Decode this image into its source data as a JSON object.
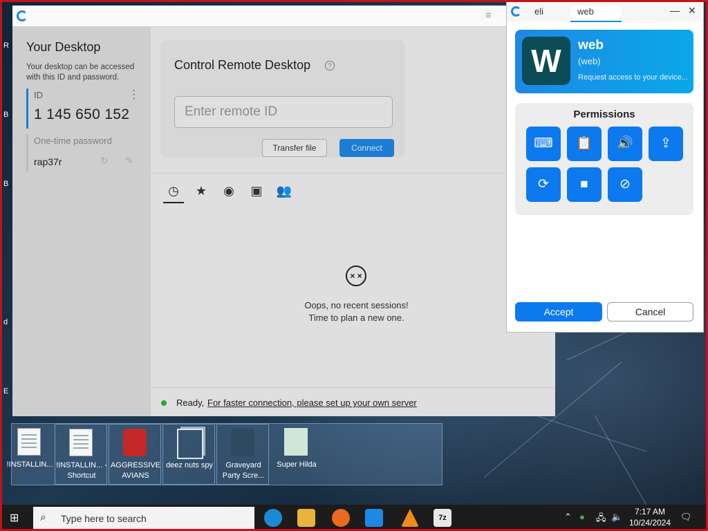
{
  "main_window": {
    "sidebar": {
      "title": "Your Desktop",
      "description": "Your desktop can be accessed with this ID and password.",
      "id_label": "ID",
      "id_value": "1 145 650 152",
      "password_label": "One-time password",
      "password_value": "rap37r"
    },
    "control": {
      "title": "Control Remote Desktop",
      "input_placeholder": "Enter remote ID",
      "transfer_label": "Transfer file",
      "connect_label": "Connect"
    },
    "tabs": [
      "recent-sessions",
      "favorites",
      "discovered",
      "address-book",
      "group"
    ],
    "empty_state": {
      "line1": "Oops, no recent sessions!",
      "line2": "Time to plan a new one."
    },
    "status": {
      "ready": "Ready,",
      "link": "For faster connection, please set up your own server"
    }
  },
  "popup": {
    "tabs": [
      "eli",
      "web"
    ],
    "active_tab": "web",
    "client": {
      "avatar_letter": "W",
      "name": "web",
      "sub": "(web)",
      "request": "Request access to your device..."
    },
    "permissions_title": "Permissions",
    "permissions": [
      "keyboard",
      "clipboard",
      "audio",
      "file-transfer",
      "restart",
      "recording",
      "block-input"
    ],
    "accept_label": "Accept",
    "cancel_label": "Cancel",
    "accent": "#0d79ee"
  },
  "desktop_icons": [
    {
      "label": "!INSTALLIN...",
      "icon": "document-icon"
    },
    {
      "label": "!INSTALLIN... - Shortcut",
      "icon": "document-icon"
    },
    {
      "label": "AGGRESSIVE AVIANS",
      "icon": "game-icon"
    },
    {
      "label": "deez nuts spy",
      "icon": "shortcut-icon"
    },
    {
      "label": "Graveyard Party Scre...",
      "icon": "game-icon"
    },
    {
      "label": "Super Hilda",
      "icon": "game-icon"
    }
  ],
  "taskbar": {
    "search_placeholder": "Type here to search",
    "time": "7:17 AM",
    "date": "10/24/2024"
  }
}
